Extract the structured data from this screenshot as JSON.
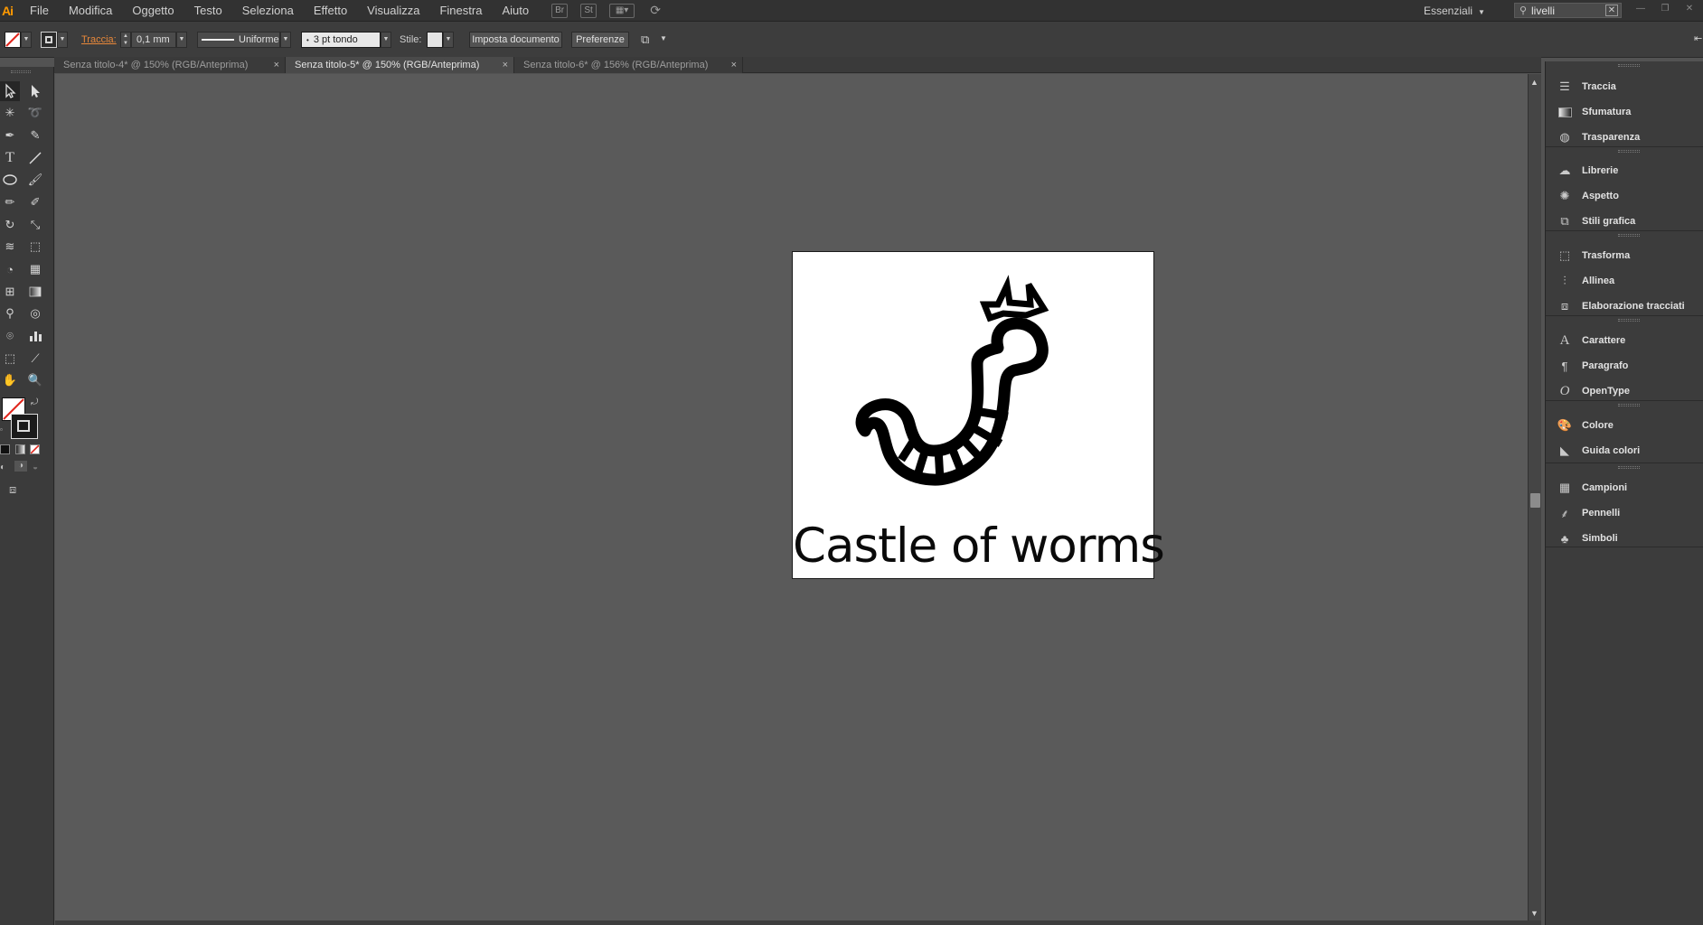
{
  "app": {
    "logo": "Ai",
    "menu": [
      "File",
      "Modifica",
      "Oggetto",
      "Testo",
      "Seleziona",
      "Effetto",
      "Visualizza",
      "Finestra",
      "Aiuto"
    ],
    "stock_icon": "St",
    "workspace": "Essenziali",
    "search_value": "livelli"
  },
  "control_bar": {
    "stroke_label": "Traccia:",
    "stroke_weight": "0,1 mm",
    "stroke_profile": "Uniforme",
    "brush": "3 pt tondo",
    "style_label": "Stile:",
    "document_setup": "Imposta documento",
    "preferences": "Preferenze"
  },
  "tabs": [
    {
      "label": "Senza titolo-4* @ 150% (RGB/Anteprima)"
    },
    {
      "label": "Senza titolo-5* @ 150% (RGB/Anteprima)"
    },
    {
      "label": "Senza titolo-6* @ 156% (RGB/Anteprima)"
    }
  ],
  "artboard": {
    "title": "Castle of worms"
  },
  "panels": [
    {
      "label": "Traccia",
      "icon": "lines-icon"
    },
    {
      "label": "Sfumatura",
      "icon": "gradient-icon"
    },
    {
      "label": "Trasparenza",
      "icon": "transparency-icon"
    },
    {
      "label": "Librerie",
      "icon": "cloud-icon"
    },
    {
      "label": "Aspetto",
      "icon": "appearance-icon"
    },
    {
      "label": "Stili grafica",
      "icon": "graphic-styles-icon"
    },
    {
      "label": "Trasforma",
      "icon": "transform-icon"
    },
    {
      "label": "Allinea",
      "icon": "align-icon"
    },
    {
      "label": "Elaborazione tracciati",
      "icon": "pathfinder-icon"
    },
    {
      "label": "Carattere",
      "icon": "character-icon"
    },
    {
      "label": "Paragrafo",
      "icon": "paragraph-icon"
    },
    {
      "label": "OpenType",
      "icon": "opentype-icon"
    },
    {
      "label": "Colore",
      "icon": "color-palette-icon"
    },
    {
      "label": "Guida colori",
      "icon": "color-guide-icon"
    },
    {
      "label": "Campioni",
      "icon": "swatches-icon"
    },
    {
      "label": "Pennelli",
      "icon": "brushes-icon"
    },
    {
      "label": "Simboli",
      "icon": "symbols-icon"
    }
  ]
}
